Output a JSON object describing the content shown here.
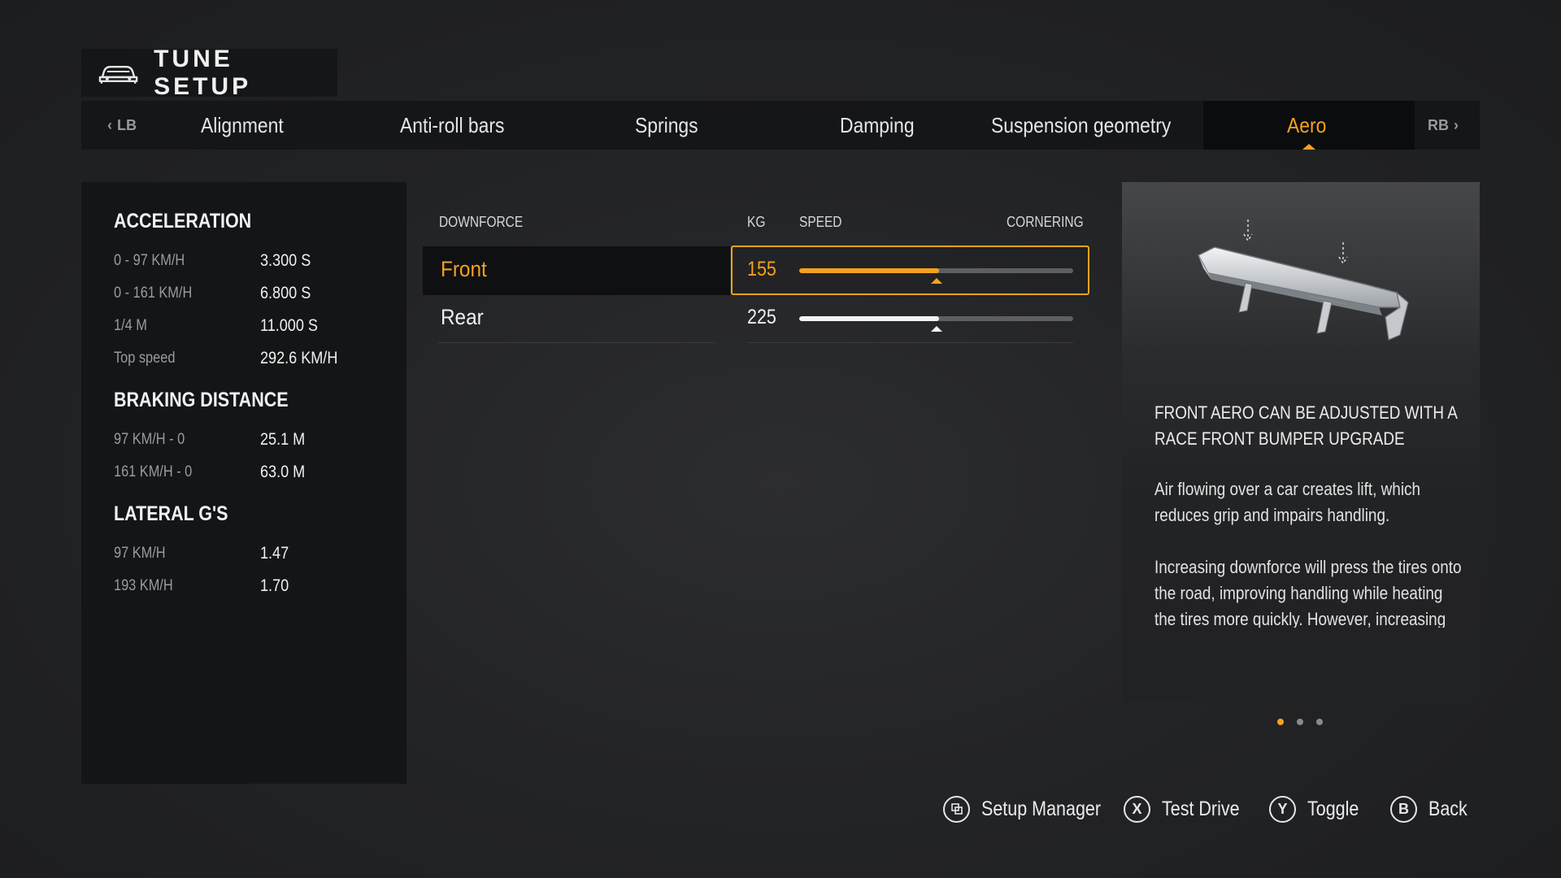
{
  "header": {
    "title": "TUNE SETUP",
    "icon": "car-icon"
  },
  "tabs": {
    "prev_bumper": "LB",
    "next_bumper": "RB",
    "items": [
      {
        "label": "Alignment",
        "active": false
      },
      {
        "label": "Anti-roll bars",
        "active": false
      },
      {
        "label": "Springs",
        "active": false
      },
      {
        "label": "Damping",
        "active": false
      },
      {
        "label": "Suspension geometry",
        "active": false
      },
      {
        "label": "Aero",
        "active": true
      }
    ]
  },
  "stats": {
    "acceleration": {
      "heading": "ACCELERATION",
      "rows": [
        {
          "label": "0 - 97 KM/H",
          "value": "3.300 S"
        },
        {
          "label": "0 - 161 KM/H",
          "value": "6.800 S"
        },
        {
          "label": "1/4 M",
          "value": "11.000 S"
        },
        {
          "label": "Top speed",
          "value": "292.6 KM/H"
        }
      ]
    },
    "braking": {
      "heading": "BRAKING DISTANCE",
      "rows": [
        {
          "label": "97 KM/H - 0",
          "value": "25.1 M"
        },
        {
          "label": "161 KM/H - 0",
          "value": "63.0 M"
        }
      ]
    },
    "lateral": {
      "heading": "LATERAL G'S",
      "rows": [
        {
          "label": "97 KM/H",
          "value": "1.47"
        },
        {
          "label": "193 KM/H",
          "value": "1.70"
        }
      ]
    }
  },
  "downforce": {
    "headers": {
      "name": "DOWNFORCE",
      "unit": "KG",
      "left": "SPEED",
      "right": "CORNERING"
    },
    "rows": [
      {
        "label": "Front",
        "value": "155",
        "fill_fraction": 0.51,
        "marker_fraction": 0.5,
        "selected": true
      },
      {
        "label": "Rear",
        "value": "225",
        "fill_fraction": 0.51,
        "marker_fraction": 0.5,
        "selected": false
      }
    ]
  },
  "info": {
    "title": "FRONT AERO CAN BE ADJUSTED WITH A RACE FRONT BUMPER UPGRADE",
    "paragraphs": [
      "Air flowing over a car creates lift, which reduces grip and impairs handling.",
      "Increasing downforce will press the tires onto the road, improving handling while heating the tires more quickly. However, increasing downforce increases drag, which reduces speed."
    ],
    "pages": 3,
    "current_page": 1,
    "image_icon": "rear-wing-icon"
  },
  "footer": [
    {
      "button": "",
      "icon": "setup-manager-icon",
      "label": "Setup Manager"
    },
    {
      "button": "X",
      "icon": "x-button-icon",
      "label": "Test Drive"
    },
    {
      "button": "Y",
      "icon": "y-button-icon",
      "label": "Toggle"
    },
    {
      "button": "B",
      "icon": "b-button-icon",
      "label": "Back"
    }
  ],
  "colors": {
    "accent": "#f4a21f",
    "panel": "#141517",
    "background": "#242527"
  }
}
